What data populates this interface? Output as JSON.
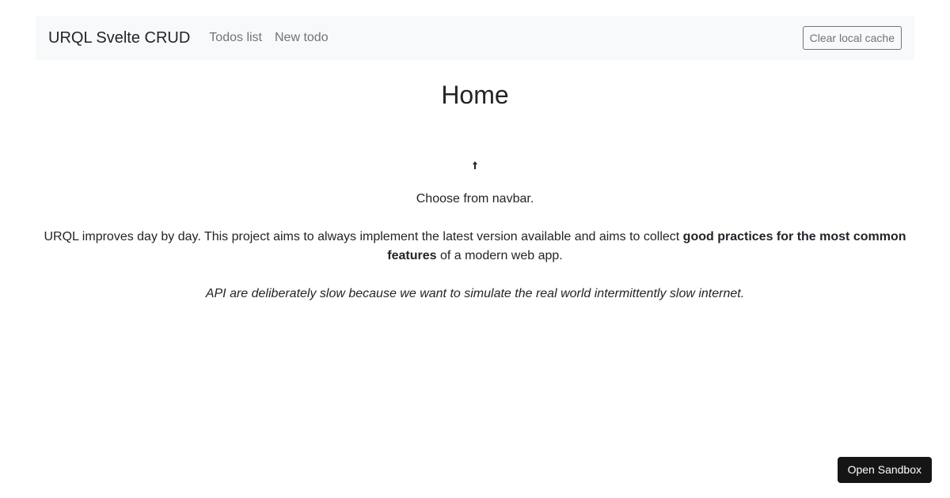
{
  "navbar": {
    "brand": "URQL Svelte CRUD",
    "links": [
      {
        "label": "Todos list"
      },
      {
        "label": "New todo"
      }
    ],
    "clear_cache_label": "Clear local cache"
  },
  "main": {
    "title": "Home",
    "pointer_icon": "up-arrow-icon",
    "choose_text": "Choose from navbar.",
    "intro_before_bold": "URQL improves day by day. This project aims to always implement the latest version available and aims to collect ",
    "intro_bold": "good practices for the most common features",
    "intro_after_bold": " of a modern web app.",
    "note": "API are deliberately slow because we want to simulate the real world intermittently slow internet."
  },
  "sandbox": {
    "label": "Open Sandbox"
  }
}
